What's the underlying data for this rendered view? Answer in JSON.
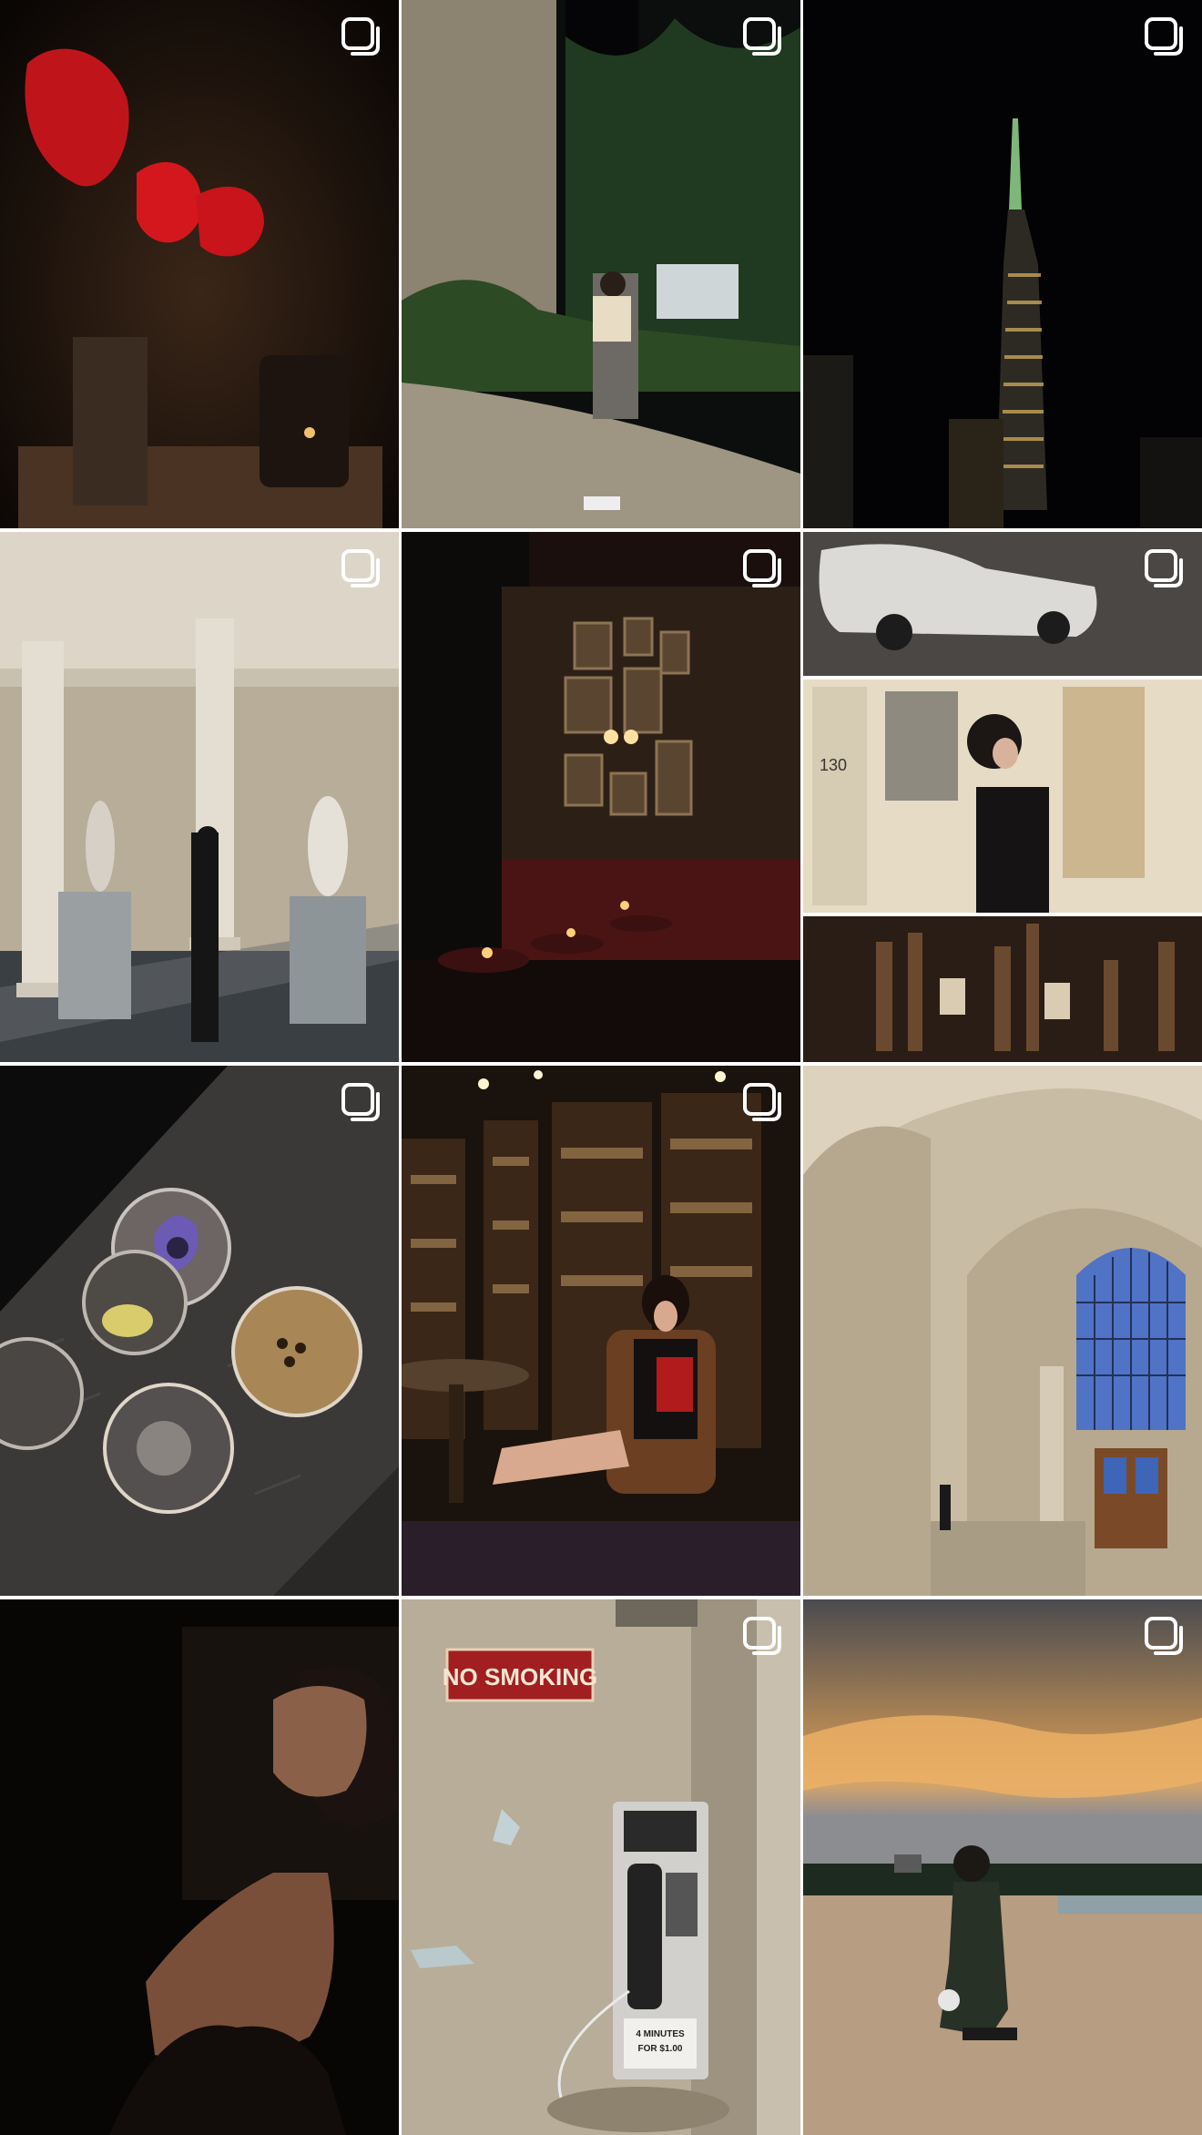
{
  "grid": {
    "columns": 3,
    "rows": 4,
    "posts": [
      {
        "name": "red-flowers-shelf",
        "multi": true
      },
      {
        "name": "garden-night-portrait",
        "multi": true
      },
      {
        "name": "city-tower-night",
        "multi": true
      },
      {
        "name": "museum-hall",
        "multi": true
      },
      {
        "name": "dark-bar-lounge",
        "multi": true
      },
      {
        "name": "car-door-bottles-collage",
        "multi": true
      },
      {
        "name": "cocktails-top-view",
        "multi": true
      },
      {
        "name": "library-bar-portrait",
        "multi": true
      },
      {
        "name": "library-arch-window",
        "multi": false
      },
      {
        "name": "shadow-portrait",
        "multi": false
      },
      {
        "name": "payphone-wall",
        "multi": true
      },
      {
        "name": "beach-sunset",
        "multi": true
      }
    ]
  },
  "overlay_icon": "carousel-icon",
  "text": {
    "door_number": "130",
    "sign": "NO SMOKING",
    "payphone_rate": "4 MINUTES",
    "payphone_rate2": "FOR $1.00"
  }
}
